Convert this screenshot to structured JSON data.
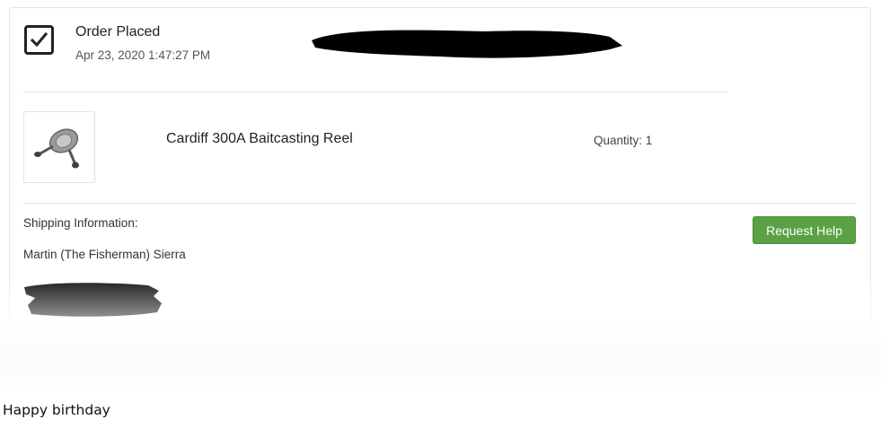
{
  "order": {
    "status": "Order Placed",
    "date": "Apr 23, 2020 1:47:27 PM"
  },
  "item": {
    "name": "Cardiff 300A Baitcasting Reel",
    "quantity_label": "Quantity: 1",
    "image_icon": "fishing-reel-thumbnail"
  },
  "shipping": {
    "label": "Shipping Information:",
    "name": "Martin (The Fisherman) Sierra"
  },
  "actions": {
    "help_label": "Request Help"
  },
  "caption": "Happy birthday",
  "colors": {
    "help_button": "#5aa244",
    "redaction": "#000000"
  }
}
